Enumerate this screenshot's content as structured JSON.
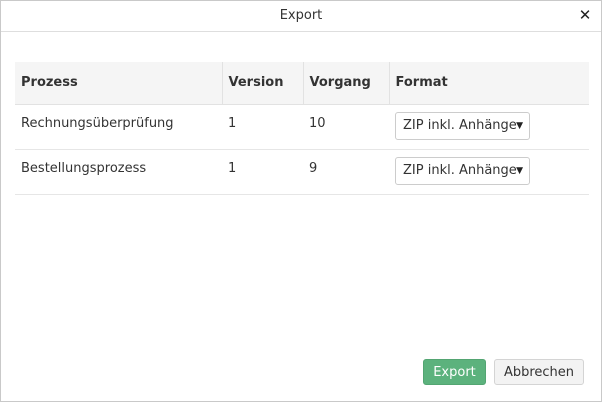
{
  "dialog": {
    "title": "Export",
    "close_icon": "close-icon"
  },
  "table": {
    "headers": [
      "Prozess",
      "Version",
      "Vorgang",
      "Format"
    ],
    "rows": [
      {
        "prozess": "Rechnungsüberprüfung",
        "version": "1",
        "vorgang": "10",
        "format": "ZIP inkl. Anhänge"
      },
      {
        "prozess": "Bestellungsprozess",
        "version": "1",
        "vorgang": "9",
        "format": "ZIP inkl. Anhänge"
      }
    ]
  },
  "footer": {
    "export_label": "Export",
    "cancel_label": "Abbrechen"
  },
  "colors": {
    "primary_button": "#5cb27d",
    "header_background": "#f5f5f5"
  }
}
